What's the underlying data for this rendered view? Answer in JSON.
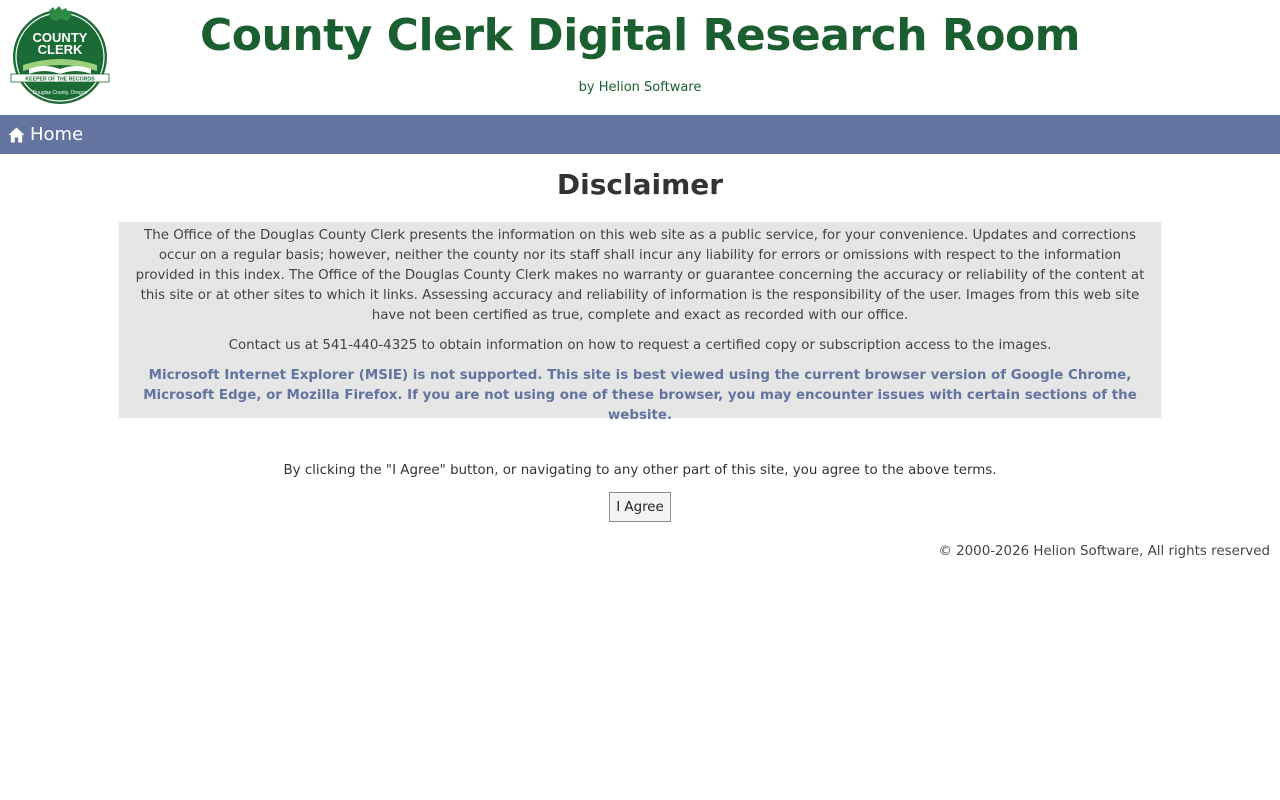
{
  "header": {
    "logo_text_line1": "COUNTY",
    "logo_text_line2": "CLERK",
    "logo_banner": "KEEPER OF THE RECORDS",
    "logo_arc": "Douglas County, Oregon",
    "title": "County Clerk Digital Research Room",
    "byline": "by Helion Software"
  },
  "nav": {
    "home_label": "Home",
    "home_icon": "house-icon"
  },
  "main": {
    "heading": "Disclaimer",
    "paragraphs": [
      "The Office of the Douglas County Clerk presents the information on this web site as a public service, for your convenience. Updates and corrections occur on a regular basis; however, neither the county nor its staff shall incur any liability for errors or omissions with respect to the information provided in this index. The Office of the Douglas County Clerk makes no warranty or guarantee concerning the accuracy or reliability of the content at this site or at other sites to which it links. Assessing accuracy and reliability of information is the responsibility of the user. Images from this web site have not been certified as true, complete and exact as recorded with our office.",
      "Contact us at 541-440-4325 to obtain information on how to request a certified copy or subscription access to the images.",
      "Microsoft Internet Explorer (MSIE) is not supported. This site is best viewed using the current browser version of Google Chrome, Microsoft Edge, or Mozilla Firefox. If you are not using one of these browser, you may encounter issues with certain sections of the website."
    ],
    "agree_text": "By clicking the \"I Agree\" button, or navigating to any other part of this site, you agree to the above terms.",
    "agree_button": "I Agree"
  },
  "footer": {
    "copyright": "© 2000-2026 Helion Software, All rights reserved"
  },
  "colors": {
    "brand_green": "#1b5e2f",
    "nav_blue": "#6474a0",
    "box_gray": "#e5e5e5"
  }
}
